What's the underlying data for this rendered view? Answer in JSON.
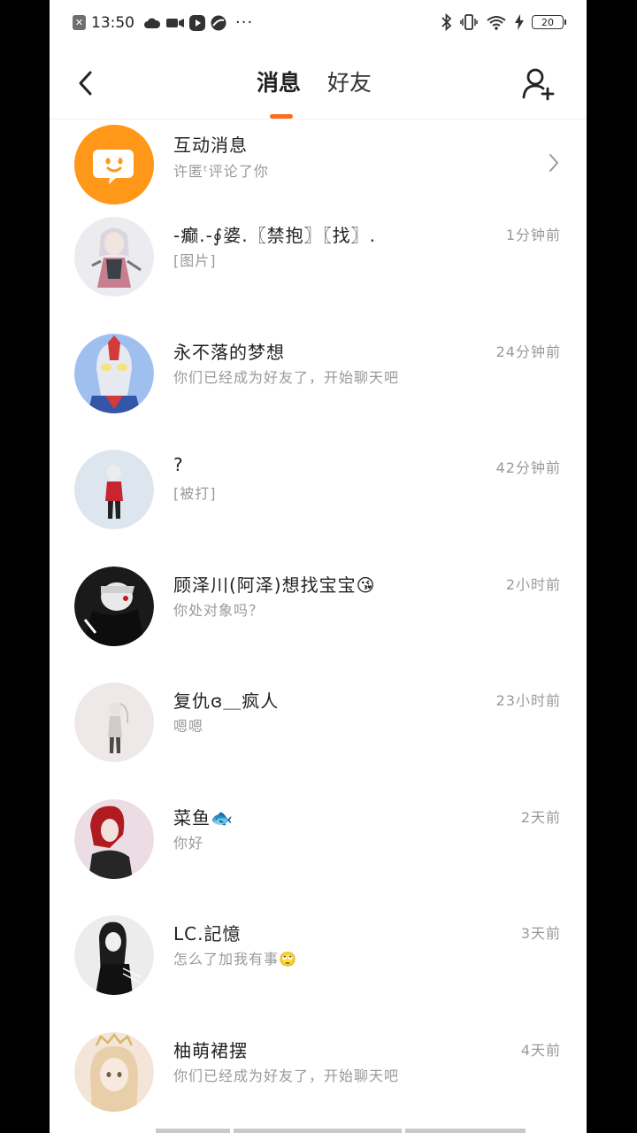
{
  "status_bar": {
    "time": "13:50",
    "dots": "···",
    "battery": "20"
  },
  "header": {
    "tabs": [
      {
        "label": "消息"
      },
      {
        "label": "好友"
      }
    ]
  },
  "interaction": {
    "title": "互动消息",
    "preview": "许匿ᵗ评论了你"
  },
  "conversations": [
    {
      "name": "-癫.-∮婆.〖禁抱〗〖找〗.",
      "preview": "[图片]",
      "time": "1分钟前"
    },
    {
      "name": "永不落的梦想",
      "preview": "你们已经成为好友了，开始聊天吧",
      "time": "24分钟前"
    },
    {
      "name": "?",
      "preview": "[被打]",
      "time": "42分钟前"
    },
    {
      "name": "顾泽川(阿泽)想找宝宝😘",
      "preview": "你处对象吗？",
      "time": "2小时前"
    },
    {
      "name": "复仇ɞ＿疯人",
      "preview": "嗯嗯",
      "time": "23小时前"
    },
    {
      "name": "菜鱼🐟",
      "preview": "你好",
      "time": "2天前"
    },
    {
      "name": "LC.記憶",
      "preview": "怎么了加我有事🙄",
      "time": "3天前"
    },
    {
      "name": "柚萌裙摆",
      "preview": "你们已经成为好友了，开始聊天吧",
      "time": "4天前"
    }
  ],
  "colors": {
    "accent": "#ff6a1f",
    "interaction_icon_bg": "#ff9a1a"
  }
}
